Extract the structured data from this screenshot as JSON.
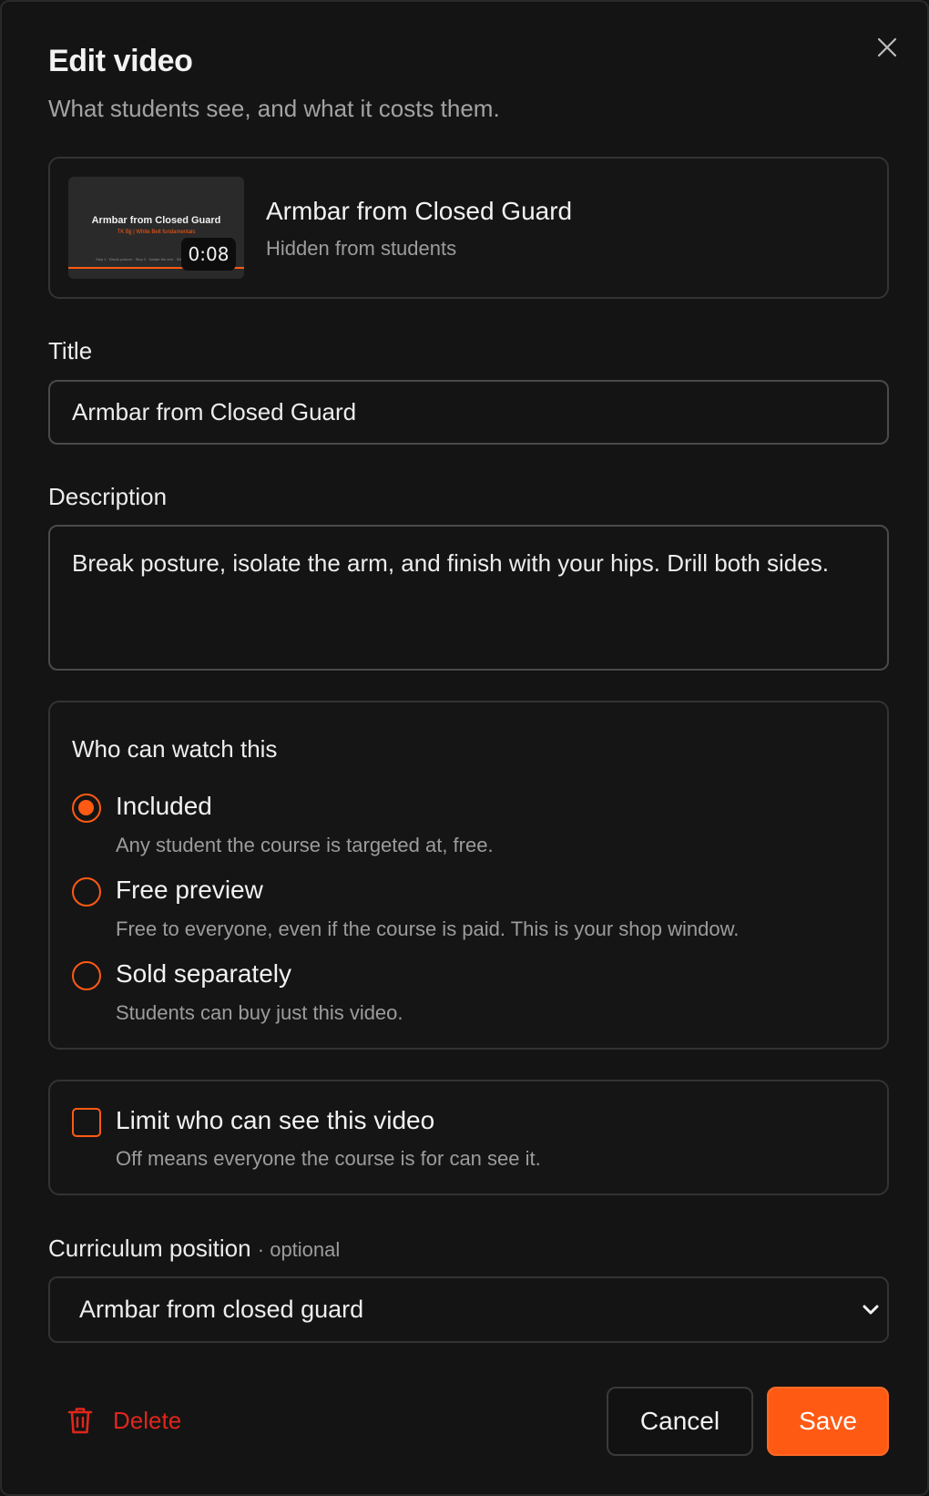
{
  "header": {
    "title": "Edit video",
    "subtitle": "What students see, and what it costs them."
  },
  "video": {
    "title": "Armbar from Closed Guard",
    "status": "Hidden from students",
    "duration": "0:08",
    "thumbnail": {
      "title": "Armbar from Closed Guard",
      "subtitle": "TK Bjj | White Belt fundamentals",
      "footer": "Step 1 · Break posture · Step 2 · Isolate the arm · Step 3"
    }
  },
  "fields": {
    "title_label": "Title",
    "title_value": "Armbar from Closed Guard",
    "description_label": "Description",
    "description_value": "Break posture, isolate the arm, and finish with your hips. Drill both sides."
  },
  "access": {
    "heading": "Who can watch this",
    "options": [
      {
        "label": "Included",
        "description": "Any student the course is targeted at, free.",
        "checked": true
      },
      {
        "label": "Free preview",
        "description": "Free to everyone, even if the course is paid. This is your shop window.",
        "checked": false
      },
      {
        "label": "Sold separately",
        "description": "Students can buy just this video.",
        "checked": false
      }
    ]
  },
  "limit": {
    "label": "Limit who can see this video",
    "description": "Off means everyone the course is for can see it.",
    "checked": false
  },
  "curriculum": {
    "label": "Curriculum position",
    "optional": "· optional",
    "selected": "Armbar from closed guard"
  },
  "actions": {
    "delete": "Delete",
    "cancel": "Cancel",
    "save": "Save"
  },
  "colors": {
    "accent": "#ff5a14",
    "danger": "#e0261b",
    "background": "#141414"
  }
}
